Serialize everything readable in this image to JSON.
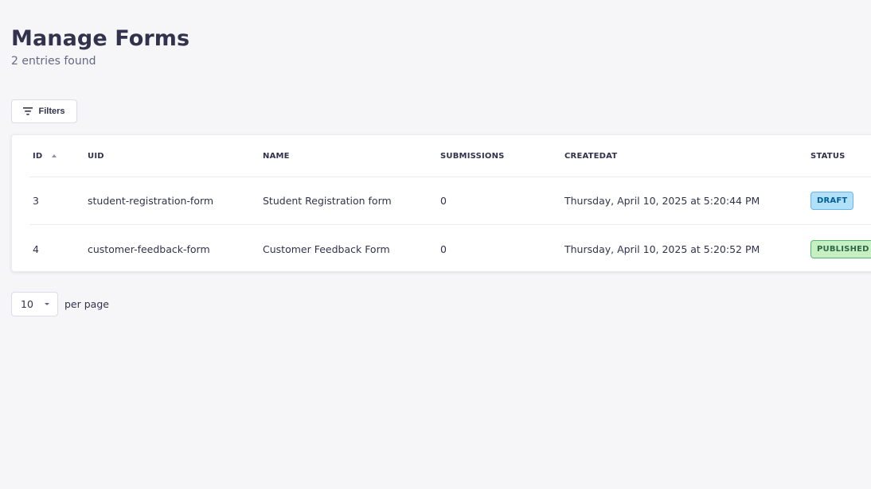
{
  "header": {
    "title": "Manage Forms",
    "subtitle": "2 entries found"
  },
  "toolbar": {
    "filters_label": "Filters",
    "filters_icon": "filter-icon"
  },
  "table": {
    "columns": {
      "id": "ID",
      "uid": "UID",
      "name": "NAME",
      "submissions": "SUBMISSIONS",
      "createdat": "CREATEDAT",
      "status": "STATUS"
    },
    "rows": [
      {
        "id": "3",
        "uid": "student-registration-form",
        "name": "Student Registration form",
        "submissions": "0",
        "createdat": "Thursday, April 10, 2025 at 5:20:44 PM",
        "status": "DRAFT"
      },
      {
        "id": "4",
        "uid": "customer-feedback-form",
        "name": "Customer Feedback Form",
        "submissions": "0",
        "createdat": "Thursday, April 10, 2025 at 5:20:52 PM",
        "status": "PUBLISHED"
      }
    ]
  },
  "pagination": {
    "page_size": "10",
    "per_page_label": "per page"
  },
  "colors": {
    "background": "#f6f6f9",
    "text": "#32324d",
    "draft_bg": "#b3e0f9",
    "published_bg": "#c6f0c2"
  }
}
